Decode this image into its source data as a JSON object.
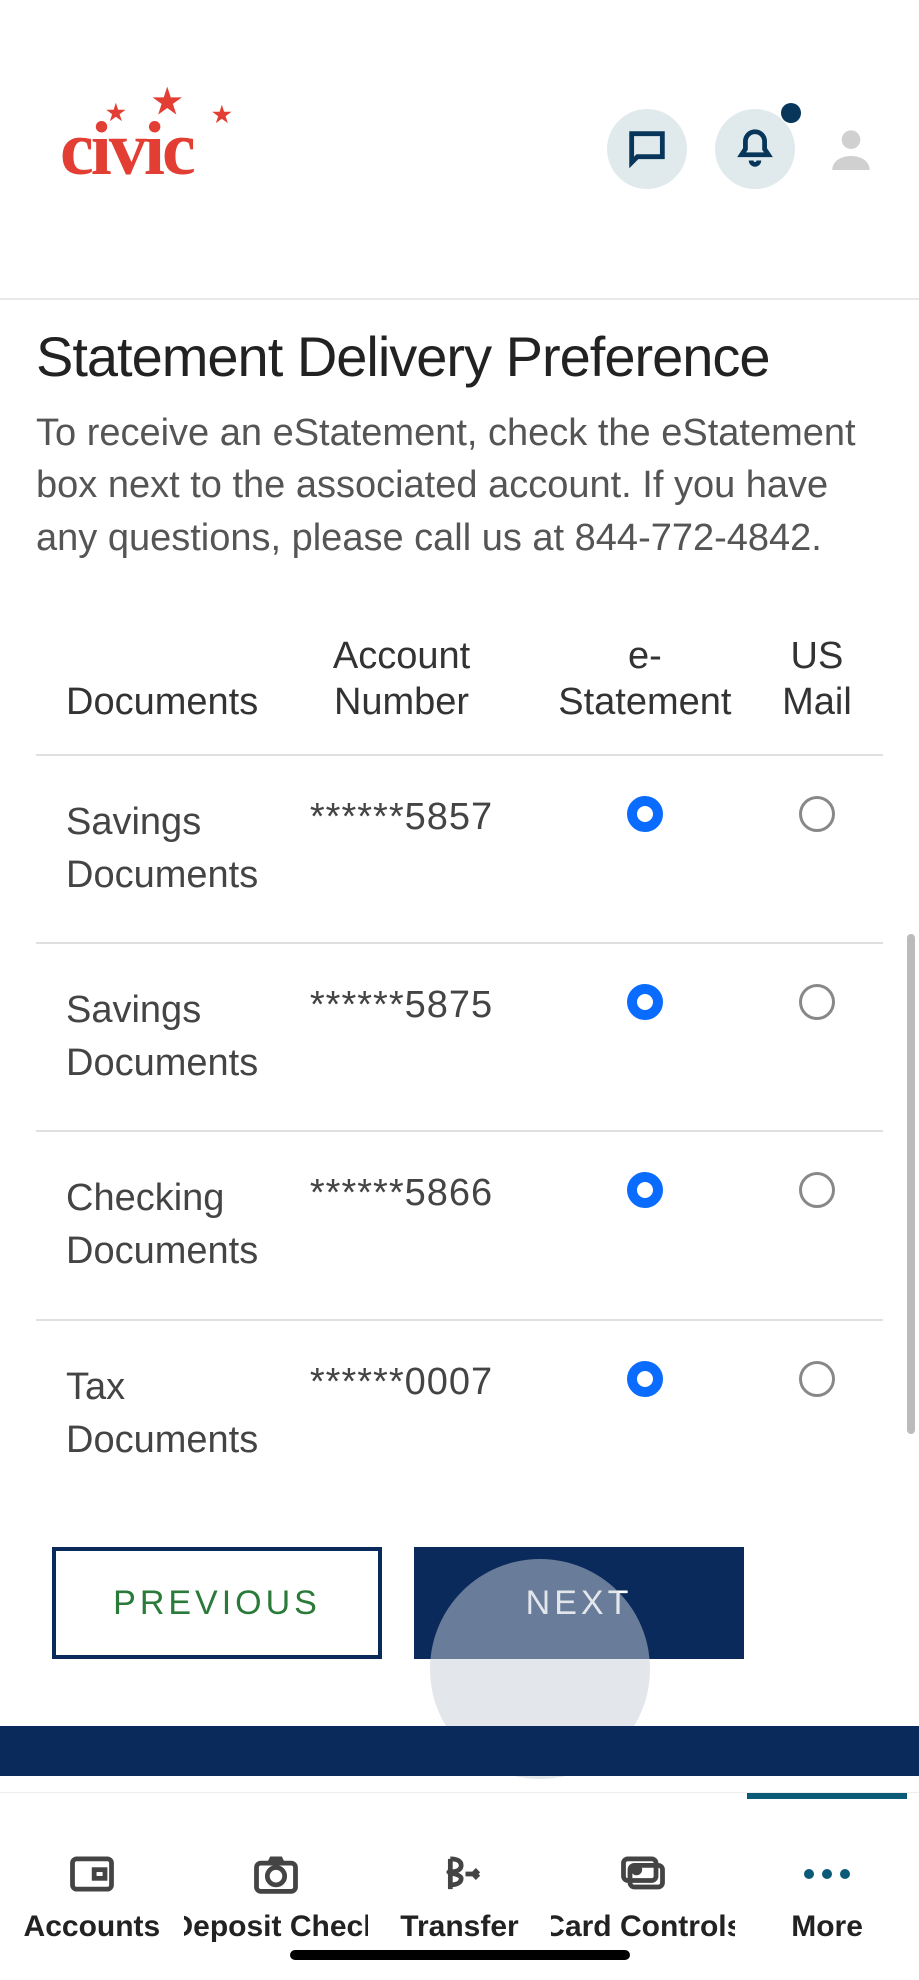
{
  "logo_text": "civic",
  "title": "Statement Delivery Preference",
  "description": "To receive an eStatement, check the eStatement box next to the associated account. If you have any questions, please call us at 844-772-4842.",
  "table": {
    "headers": {
      "documents": "Documents",
      "account": "Account Number",
      "estatement": "e-Statement",
      "mail": "US Mail"
    },
    "rows": [
      {
        "doc": "Savings Documents",
        "acct": "******5857",
        "estatement": true,
        "mail": false
      },
      {
        "doc": "Savings Documents",
        "acct": "******5875",
        "estatement": true,
        "mail": false
      },
      {
        "doc": "Checking Documents",
        "acct": "******5866",
        "estatement": true,
        "mail": false
      },
      {
        "doc": "Tax Documents",
        "acct": "******0007",
        "estatement": true,
        "mail": false
      }
    ]
  },
  "buttons": {
    "previous": "PREVIOUS",
    "next": "NEXT"
  },
  "nav": {
    "accounts": "Accounts",
    "deposit": "Deposit Check",
    "transfer": "Transfer",
    "card": "Card Controls",
    "more": "More"
  }
}
